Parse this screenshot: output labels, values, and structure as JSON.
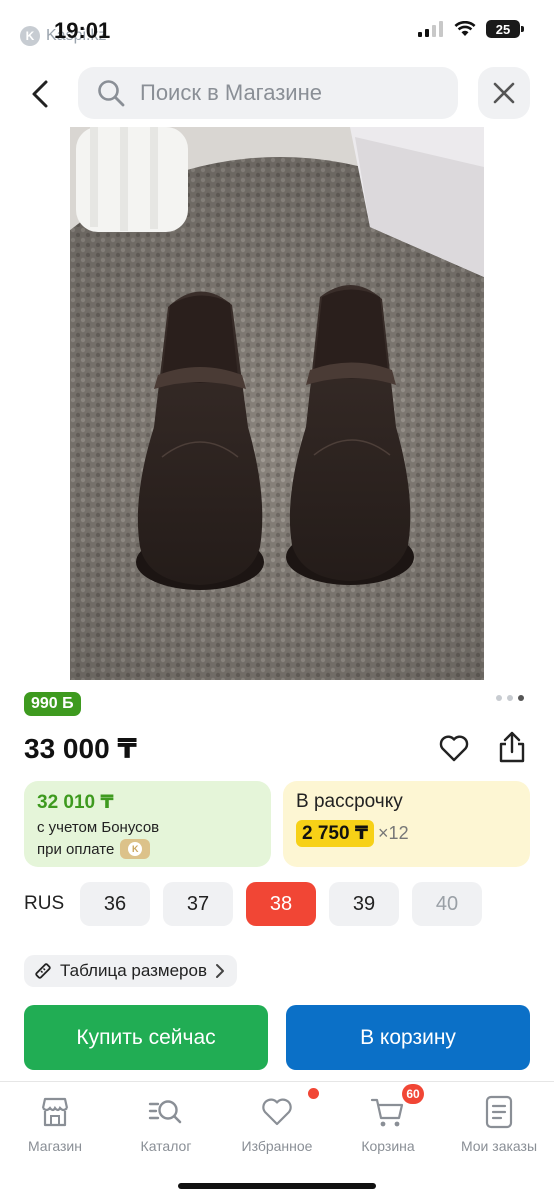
{
  "status_bar": {
    "time": "19:01",
    "carrier": "Kaspi.kz",
    "battery": "25"
  },
  "search": {
    "placeholder": "Поиск в Магазине",
    "value": ""
  },
  "product": {
    "bonus_badge": "990 Б",
    "price": "33 000 ₸",
    "image_count": 3,
    "active_image": 3
  },
  "bonus_card": {
    "price": "32 010 ₸",
    "line1": "с учетом Бонусов",
    "line2": "при оплате"
  },
  "installment_card": {
    "title": "В рассрочку",
    "amount": "2 750 ₸",
    "months": "×12"
  },
  "sizes": {
    "label": "RUS",
    "options": [
      {
        "value": "36",
        "state": "available"
      },
      {
        "value": "37",
        "state": "available"
      },
      {
        "value": "38",
        "state": "selected"
      },
      {
        "value": "39",
        "state": "available"
      },
      {
        "value": "40",
        "state": "unavailable"
      }
    ]
  },
  "size_table": {
    "label": "Таблица размеров"
  },
  "actions": {
    "buy_now": "Купить сейчас",
    "add_to_cart": "В корзину"
  },
  "bottom_nav": {
    "items": [
      {
        "label": "Магазин",
        "icon": "store-icon"
      },
      {
        "label": "Каталог",
        "icon": "catalog-search-icon"
      },
      {
        "label": "Избранное",
        "icon": "heart-icon"
      },
      {
        "label": "Корзина",
        "icon": "cart-icon",
        "badge": "60"
      },
      {
        "label": "Мои заказы",
        "icon": "orders-icon"
      }
    ]
  },
  "colors": {
    "bonus_green": "#3e9a1f",
    "buy_green": "#21ad54",
    "cart_blue": "#0b70c7",
    "selected_red": "#f14635",
    "installment_yellow": "#f7d117"
  }
}
